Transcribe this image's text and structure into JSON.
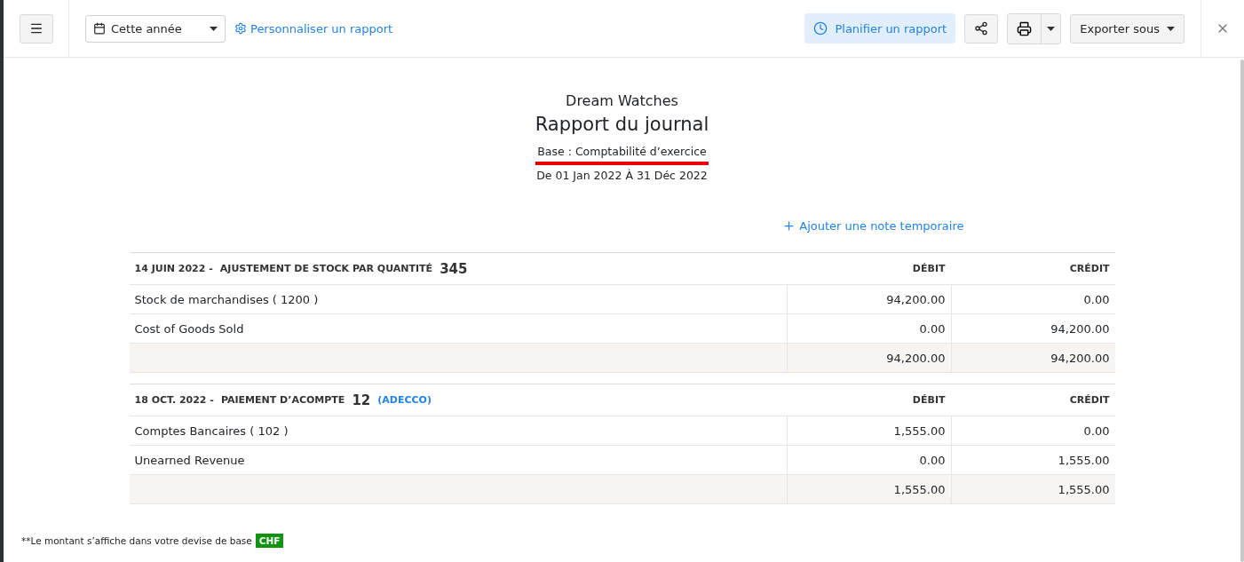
{
  "toolbar": {
    "period": "Cette année",
    "customize": "Personnaliser un rapport",
    "schedule": "Planifier un rapport",
    "export": "Exporter sous"
  },
  "report": {
    "company": "Dream Watches",
    "title": "Rapport du journal",
    "basis": "Base : Comptabilité d’exercice",
    "basis_underlined": true,
    "range": "De 01 Jan 2022 À 31 Déc 2022"
  },
  "add_note": "Ajouter une note temporaire",
  "entries": [
    {
      "date": "14 JUIN 2022 -",
      "type": "AJUSTEMENT DE STOCK PAR QUANTITÉ",
      "number": "345",
      "debit_header": "DÉBIT",
      "credit_header": "CRÉDIT",
      "rows": [
        {
          "account": "Stock de marchandises ( 1200 )",
          "debit": "94,200.00",
          "credit": "0.00"
        },
        {
          "account": "Cost of Goods Sold",
          "debit": "0.00",
          "credit": "94,200.00"
        }
      ],
      "total_debit": "94,200.00",
      "total_credit": "94,200.00"
    },
    {
      "date": "18 OCT. 2022 -",
      "type": "PAIEMENT D’ACOMPTE",
      "number": "12",
      "contact": "(ADECCO)",
      "debit_header": "DÉBIT",
      "credit_header": "CRÉDIT",
      "rows": [
        {
          "account": "Comptes Bancaires ( 102 )",
          "debit": "1,555.00",
          "credit": "0.00"
        },
        {
          "account": "Unearned Revenue",
          "debit": "0.00",
          "credit": "1,555.00"
        }
      ],
      "total_debit": "1,555.00",
      "total_credit": "1,555.00"
    }
  ],
  "footnote": {
    "text": "**Le montant s’affiche dans votre devise de base",
    "currency": "CHF"
  }
}
